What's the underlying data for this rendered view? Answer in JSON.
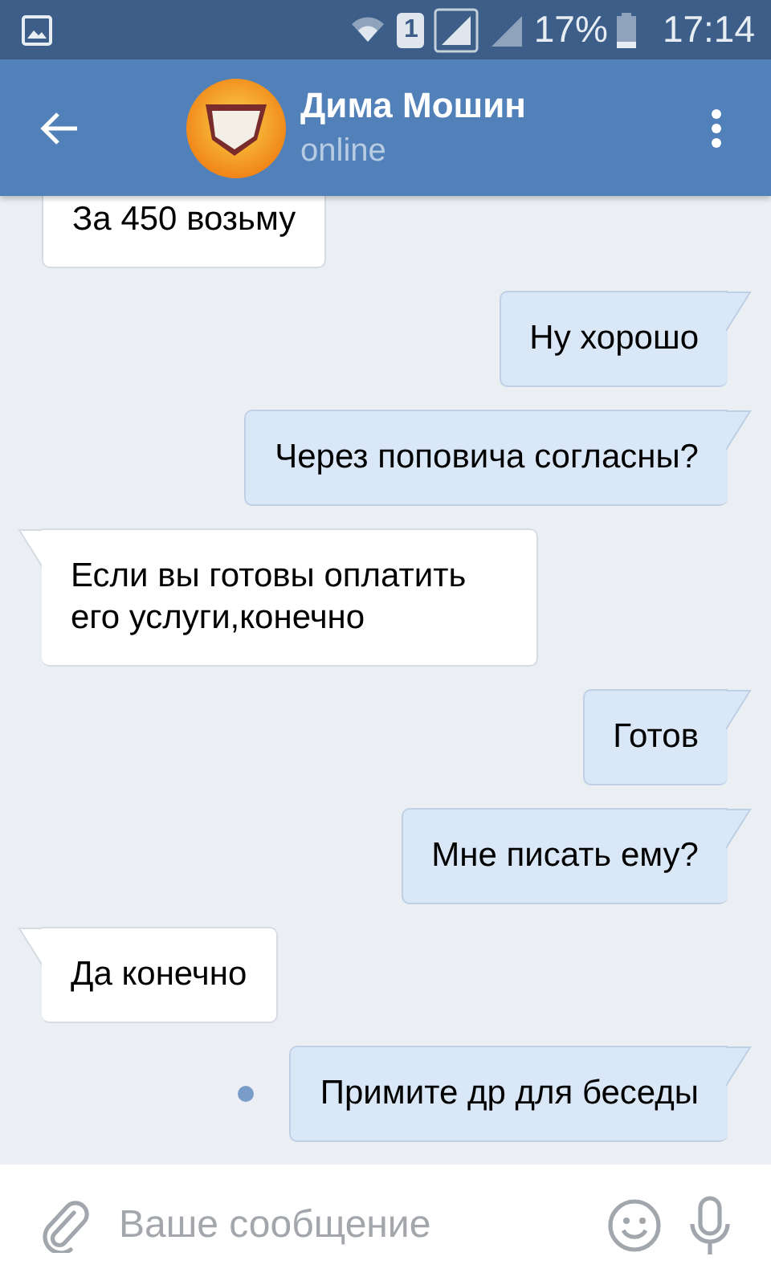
{
  "status_bar": {
    "sim_slot": "1",
    "battery": "17%",
    "time": "17:14"
  },
  "header": {
    "name": "Дима Мошин",
    "status": "online"
  },
  "messages": [
    {
      "kind": "incoming",
      "text": "За 450 возьму",
      "tail": false,
      "unread": false
    },
    {
      "kind": "outgoing",
      "text": "Ну хорошо",
      "tail": true,
      "unread": false
    },
    {
      "kind": "outgoing",
      "text": "Через поповича согласны?",
      "tail": true,
      "unread": false
    },
    {
      "kind": "incoming",
      "text": "Если вы готовы оплатить его услуги,конечно",
      "tail": true,
      "unread": false
    },
    {
      "kind": "outgoing",
      "text": "Готов",
      "tail": true,
      "unread": false
    },
    {
      "kind": "outgoing",
      "text": "Мне писать ему?",
      "tail": true,
      "unread": false
    },
    {
      "kind": "incoming",
      "text": "Да конечно",
      "tail": true,
      "unread": false
    },
    {
      "kind": "outgoing",
      "text": "Примите др для беседы",
      "tail": true,
      "unread": true
    }
  ],
  "composer": {
    "placeholder": "Ваше сообщение"
  }
}
